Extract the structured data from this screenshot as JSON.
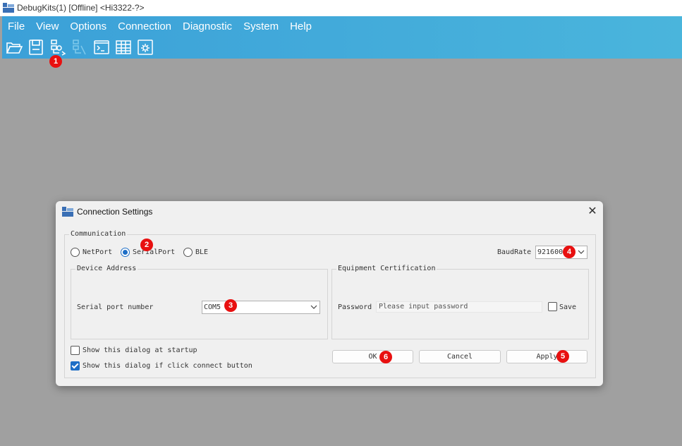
{
  "window": {
    "title": "DebugKits(1) [Offline] <Hi3322-?>"
  },
  "menu": [
    "File",
    "View",
    "Options",
    "Connection",
    "Diagnostic",
    "System",
    "Help"
  ],
  "toolbar": [
    "open-folder-icon",
    "save-icon",
    "connect-icon",
    "disconnect-icon",
    "terminal-icon",
    "table-icon",
    "settings-icon"
  ],
  "dialog": {
    "title": "Connection Settings",
    "communication": {
      "legend": "Communication",
      "options": [
        "NetPort",
        "SerialPort",
        "BLE"
      ],
      "selected": "SerialPort",
      "baud_label": "BaudRate",
      "baud_value": "921600"
    },
    "device": {
      "legend": "Device Address",
      "port_label": "Serial port number",
      "port_value": "COM5"
    },
    "cert": {
      "legend": "Equipment Certification",
      "password_label": "Password",
      "password_placeholder": "Please input password",
      "save_label": "Save"
    },
    "options": {
      "startup_label": "Show this dialog at startup",
      "startup_checked": false,
      "connect_label": "Show this dialog if click connect button",
      "connect_checked": true
    },
    "buttons": {
      "ok": "OK",
      "cancel": "Cancel",
      "apply": "Apply"
    }
  },
  "badges": [
    "1",
    "2",
    "3",
    "4",
    "5",
    "6"
  ]
}
